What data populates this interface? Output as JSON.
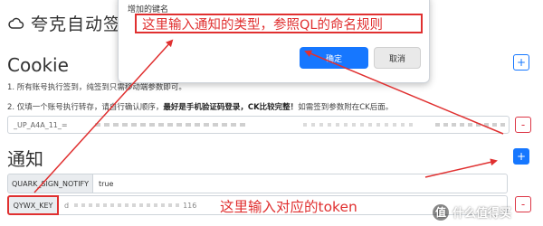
{
  "app": {
    "title": "夸克自动签",
    "logo_icon": "cloud-icon"
  },
  "cookie_section": {
    "title": "Cookie",
    "note1": "1. 所有账号执行签到，纯签到只需移动端参数即可。",
    "note2_prefix": "2. 仅填一个账号执行转存，请自行确认顺序，",
    "note2_bold": "最好是手机验证码",
    "note2_link": "登录",
    "note2_bold2": "，CK比较完整！",
    "note2_suffix": "如需签到参数附在CK后面。",
    "cookie_value": "_UP_A4A_11_=",
    "add_label": "+",
    "delete_label": "-"
  },
  "notify_section": {
    "title": "通知",
    "add_label": "+",
    "rows": [
      {
        "key": "QUARK_SIGN_NOTIFY",
        "value": "true"
      },
      {
        "key": "QYWX_KEY",
        "value_prefix": "d",
        "value_suffix": "116",
        "delete_label": "-"
      }
    ]
  },
  "dialog": {
    "label": "增加的键名",
    "input_value": "这里输入通知的类型，参照QL的命名规则",
    "ok_label": "确定",
    "cancel_label": "取消"
  },
  "annotation": {
    "text": "这里输入对应的token",
    "color": "#e03030"
  },
  "watermark": {
    "badge": "值",
    "text": "什么值得买"
  },
  "colors": {
    "primary": "#1677ff",
    "danger": "#dc3545",
    "annotation": "#e03030"
  }
}
